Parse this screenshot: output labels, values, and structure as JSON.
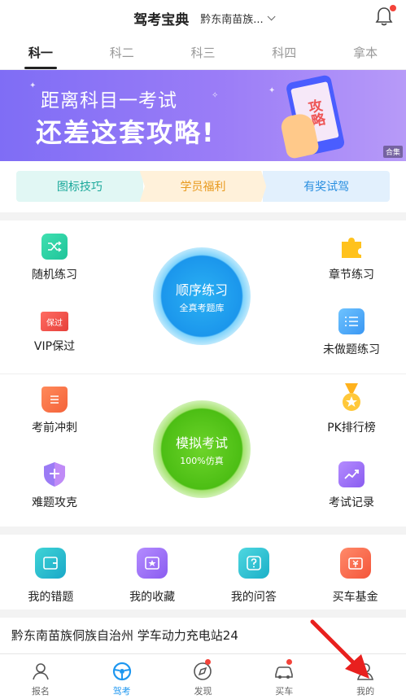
{
  "header": {
    "title": "驾考宝典",
    "city": "黔东南苗族...",
    "bell_icon": "bell-icon"
  },
  "tabs": [
    {
      "label": "科一"
    },
    {
      "label": "科二"
    },
    {
      "label": "科三"
    },
    {
      "label": "科四"
    },
    {
      "label": "拿本"
    }
  ],
  "banner": {
    "line1": "距离科目一考试",
    "line2": "还差这套攻略!",
    "phone_text": "攻略",
    "tag": "合集"
  },
  "quick_cards": [
    {
      "label": "图标技巧"
    },
    {
      "label": "学员福利"
    },
    {
      "label": "有奖试驾"
    }
  ],
  "practice": {
    "sequential": {
      "title": "顺序练习",
      "subtitle": "全真考题库"
    },
    "mock": {
      "title": "模拟考试",
      "subtitle": "100%仿真"
    },
    "items": {
      "random": "随机练习",
      "chapter": "章节练习",
      "vip": "VIP保过",
      "vip_icon_text": "保过",
      "undone": "未做题练习",
      "sprint": "考前冲刺",
      "pk": "PK排行榜",
      "hard": "难题攻克",
      "records": "考试记录"
    }
  },
  "tools": [
    {
      "label": "我的错题"
    },
    {
      "label": "我的收藏"
    },
    {
      "label": "我的问答"
    },
    {
      "label": "买车基金"
    }
  ],
  "station": {
    "text": "黔东南苗族侗族自治州 学车动力充电站24"
  },
  "nav": [
    {
      "label": "报名"
    },
    {
      "label": "驾考"
    },
    {
      "label": "发现"
    },
    {
      "label": "买车"
    },
    {
      "label": "我的"
    }
  ],
  "colors": {
    "accent": "#1e97f0",
    "banner_start": "#7f6df5",
    "badge_red": "#f4433a"
  }
}
